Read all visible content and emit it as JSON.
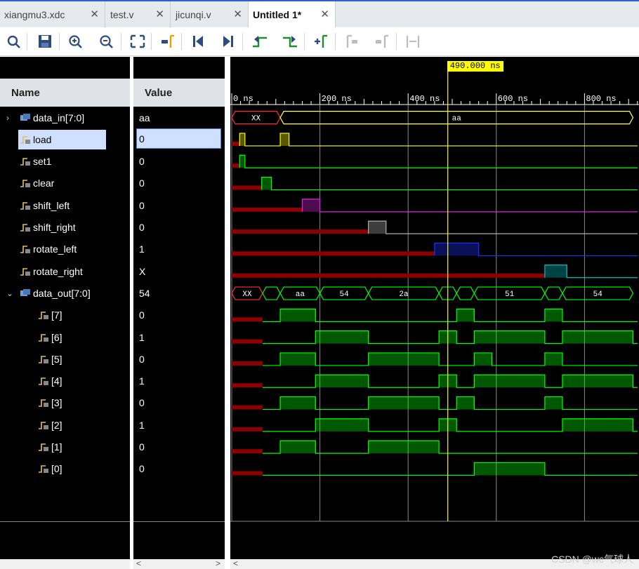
{
  "tabs": [
    {
      "label": "xiangmu3.xdc",
      "active": false
    },
    {
      "label": "test.v",
      "active": false
    },
    {
      "label": "jicunqi.v",
      "active": false
    },
    {
      "label": "Untitled 1*",
      "active": true
    }
  ],
  "toolbar": [
    "search-icon",
    "save-icon",
    "zoom-in-icon",
    "zoom-out-icon",
    "zoom-fit-icon",
    "go-to-cursor-icon",
    "go-to-start-icon",
    "go-to-end-icon",
    "previous-transition-icon",
    "next-transition-icon",
    "add-marker-icon",
    "previous-marker-icon",
    "next-marker-icon",
    "swap-cursors-icon"
  ],
  "columns": {
    "name": "Name",
    "value": "Value"
  },
  "signals": [
    {
      "name": "data_in[7:0]",
      "value": "aa",
      "type": "bus",
      "expand": "collapsed",
      "indent": 0,
      "selected": false
    },
    {
      "name": "load",
      "value": "0",
      "type": "bit",
      "expand": "",
      "indent": 0,
      "selected": true
    },
    {
      "name": "set1",
      "value": "0",
      "type": "bit",
      "expand": "",
      "indent": 0,
      "selected": false
    },
    {
      "name": "clear",
      "value": "0",
      "type": "bit",
      "expand": "",
      "indent": 0,
      "selected": false
    },
    {
      "name": "shift_left",
      "value": "0",
      "type": "bit",
      "expand": "",
      "indent": 0,
      "selected": false
    },
    {
      "name": "shift_right",
      "value": "0",
      "type": "bit",
      "expand": "",
      "indent": 0,
      "selected": false
    },
    {
      "name": "rotate_left",
      "value": "1",
      "type": "bit",
      "expand": "",
      "indent": 0,
      "selected": false
    },
    {
      "name": "rotate_right",
      "value": "X",
      "type": "bit",
      "expand": "",
      "indent": 0,
      "selected": false
    },
    {
      "name": "data_out[7:0]",
      "value": "54",
      "type": "bus",
      "expand": "expanded",
      "indent": 0,
      "selected": false
    },
    {
      "name": "[7]",
      "value": "0",
      "type": "bit",
      "expand": "",
      "indent": 1,
      "selected": false
    },
    {
      "name": "[6]",
      "value": "1",
      "type": "bit",
      "expand": "",
      "indent": 1,
      "selected": false
    },
    {
      "name": "[5]",
      "value": "0",
      "type": "bit",
      "expand": "",
      "indent": 1,
      "selected": false
    },
    {
      "name": "[4]",
      "value": "1",
      "type": "bit",
      "expand": "",
      "indent": 1,
      "selected": false
    },
    {
      "name": "[3]",
      "value": "0",
      "type": "bit",
      "expand": "",
      "indent": 1,
      "selected": false
    },
    {
      "name": "[2]",
      "value": "1",
      "type": "bit",
      "expand": "",
      "indent": 1,
      "selected": false
    },
    {
      "name": "[1]",
      "value": "0",
      "type": "bit",
      "expand": "",
      "indent": 1,
      "selected": false
    },
    {
      "name": "[0]",
      "value": "0",
      "type": "bit",
      "expand": "",
      "indent": 1,
      "selected": false
    }
  ],
  "timeline": {
    "ticks": [
      {
        "t": 0,
        "label": "0 ns"
      },
      {
        "t": 200,
        "label": "200 ns"
      },
      {
        "t": 400,
        "label": "400 ns"
      },
      {
        "t": 600,
        "label": "600 ns"
      },
      {
        "t": 800,
        "label": "800 ns"
      }
    ],
    "cursor_ns": 490,
    "cursor_label": "490.000 ns"
  },
  "waves": [
    {
      "kind": "bus",
      "color": "#ffff66",
      "segments": [
        {
          "t0": 0,
          "t1": 110,
          "label": "XX",
          "x": true
        },
        {
          "t0": 110,
          "t1": 910,
          "label": "aa",
          "x": false
        }
      ]
    },
    {
      "kind": "bit",
      "color": "#ffff00",
      "highs": [
        [
          18,
          30
        ],
        [
          110,
          130
        ]
      ],
      "xuntil": 18
    },
    {
      "kind": "bit",
      "color": "#00ff00",
      "highs": [
        [
          18,
          30
        ]
      ],
      "xuntil": 18
    },
    {
      "kind": "bit",
      "color": "#00ff00",
      "highs": [
        [
          68,
          90
        ]
      ],
      "xuntil": 68
    },
    {
      "kind": "bit",
      "color": "#e020e0",
      "highs": [
        [
          160,
          200
        ]
      ],
      "xuntil": 160
    },
    {
      "kind": "bit",
      "color": "#b0b0b0",
      "highs": [
        [
          310,
          350
        ]
      ],
      "xuntil": 310
    },
    {
      "kind": "bit",
      "color": "#2030ff",
      "highs": [
        [
          460,
          560
        ]
      ],
      "xuntil": 460
    },
    {
      "kind": "bit",
      "color": "#00c0c0",
      "highs": [
        [
          710,
          760
        ]
      ],
      "xuntil": 710
    },
    {
      "kind": "bus",
      "color": "#00ff00",
      "segments": [
        {
          "t0": 0,
          "t1": 70,
          "label": "XX",
          "x": true
        },
        {
          "t0": 70,
          "t1": 110,
          "label": "",
          "x": false
        },
        {
          "t0": 110,
          "t1": 200,
          "label": "aa",
          "x": false
        },
        {
          "t0": 200,
          "t1": 310,
          "label": "54",
          "x": false
        },
        {
          "t0": 310,
          "t1": 470,
          "label": "2a",
          "x": false
        },
        {
          "t0": 470,
          "t1": 510,
          "label": "",
          "x": false
        },
        {
          "t0": 510,
          "t1": 550,
          "label": "",
          "x": false
        },
        {
          "t0": 550,
          "t1": 710,
          "label": "51",
          "x": false
        },
        {
          "t0": 710,
          "t1": 750,
          "label": "",
          "x": false
        },
        {
          "t0": 750,
          "t1": 910,
          "label": "54",
          "x": false
        }
      ]
    },
    {
      "kind": "bit",
      "color": "#00ff00",
      "highs": [
        [
          110,
          190
        ],
        [
          510,
          550
        ],
        [
          710,
          750
        ]
      ],
      "xuntil": 70
    },
    {
      "kind": "bit",
      "color": "#00ff00",
      "highs": [
        [
          190,
          310
        ],
        [
          470,
          510
        ],
        [
          550,
          710
        ],
        [
          750,
          910
        ]
      ],
      "xuntil": 70
    },
    {
      "kind": "bit",
      "color": "#00ff00",
      "highs": [
        [
          110,
          190
        ],
        [
          310,
          470
        ],
        [
          550,
          590
        ],
        [
          710,
          750
        ]
      ],
      "xuntil": 70
    },
    {
      "kind": "bit",
      "color": "#00ff00",
      "highs": [
        [
          190,
          310
        ],
        [
          470,
          510
        ],
        [
          550,
          710
        ],
        [
          750,
          910
        ]
      ],
      "xuntil": 70
    },
    {
      "kind": "bit",
      "color": "#00ff00",
      "highs": [
        [
          110,
          190
        ],
        [
          310,
          470
        ],
        [
          510,
          550
        ],
        [
          710,
          750
        ]
      ],
      "xuntil": 70
    },
    {
      "kind": "bit",
      "color": "#00ff00",
      "highs": [
        [
          190,
          310
        ],
        [
          470,
          510
        ],
        [
          750,
          910
        ]
      ],
      "xuntil": 70
    },
    {
      "kind": "bit",
      "color": "#00ff00",
      "highs": [
        [
          110,
          190
        ],
        [
          310,
          470
        ]
      ],
      "xuntil": 70
    },
    {
      "kind": "bit",
      "color": "#00ff00",
      "highs": [
        [
          550,
          710
        ]
      ],
      "xuntil": 70
    }
  ],
  "scroll": {
    "left": "<",
    "right": ">"
  },
  "watermark": "CSDN @wc气球人"
}
